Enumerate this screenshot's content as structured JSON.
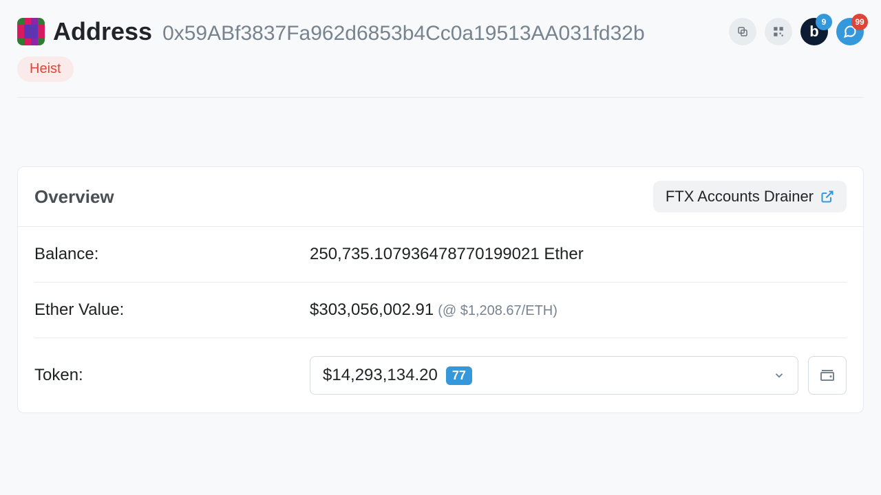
{
  "header": {
    "title": "Address",
    "hash": "0x59ABf3837Fa962d6853b4Cc0a19513AA031fd32b",
    "badge_b": "9",
    "badge_chat": "99",
    "b_letter": "b"
  },
  "tag": {
    "label": "Heist"
  },
  "card": {
    "title": "Overview",
    "drainer_label": "FTX Accounts Drainer",
    "balance_label": "Balance:",
    "balance_value": "250,735.107936478770199021 Ether",
    "ether_value_label": "Ether Value:",
    "ether_value_amount": "$303,056,002.91",
    "ether_value_rate": "(@ $1,208.67/ETH)",
    "token_label": "Token:",
    "token_amount": "$14,293,134.20",
    "token_count": "77"
  },
  "avatar_colors": [
    "#2e7d32",
    "#d81b60",
    "#8e24aa",
    "#2e7d32",
    "#d81b60",
    "#5e35b1",
    "#5e35b1",
    "#d81b60",
    "#d81b60",
    "#5e35b1",
    "#5e35b1",
    "#d81b60",
    "#2e7d32",
    "#d81b60",
    "#8e24aa",
    "#2e7d32"
  ]
}
